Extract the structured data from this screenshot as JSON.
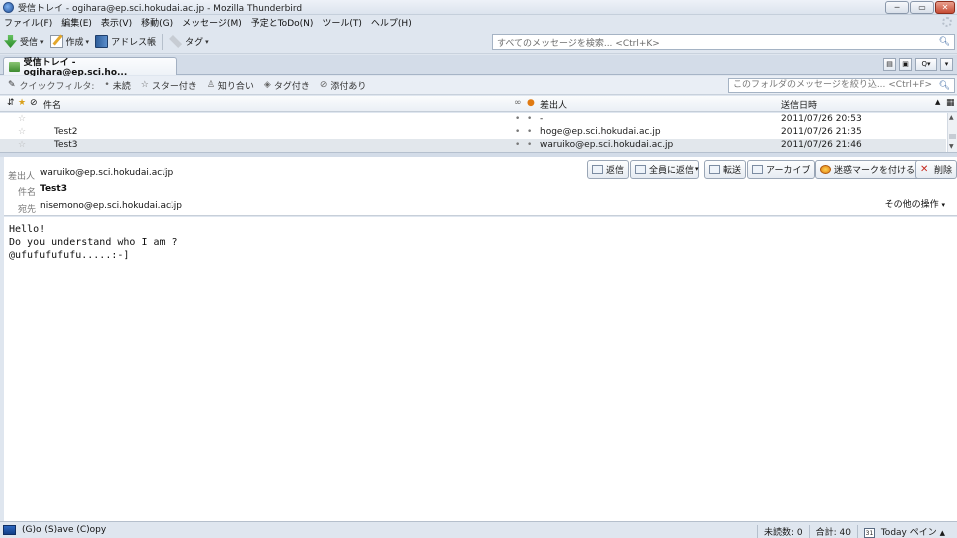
{
  "window": {
    "title": "受信トレイ - ogihara@ep.sci.hokudai.ac.jp - Mozilla Thunderbird",
    "minimize": "─",
    "maximize": "▭",
    "close": "✕"
  },
  "menubar": {
    "items": [
      "ファイル(F)",
      "編集(E)",
      "表示(V)",
      "移動(G)",
      "メッセージ(M)",
      "予定とToDo(N)",
      "ツール(T)",
      "ヘルプ(H)"
    ]
  },
  "toolbar": {
    "get_label": "受信",
    "write_label": "作成",
    "addressbook_label": "アドレス帳",
    "tag_label": "タグ",
    "search_placeholder": "すべてのメッセージを検索... <Ctrl+K>"
  },
  "tab": {
    "label": "受信トレイ - ogihara@ep.sci.ho..."
  },
  "quickfilter": {
    "label": "クイックフィルタ:",
    "unread": "未読",
    "starred": "スター付き",
    "contact": "知り合い",
    "tagged": "タグ付き",
    "attachment": "添付あり",
    "search_placeholder": "このフォルダのメッセージを絞り込... <Ctrl+F>"
  },
  "thread": {
    "col_subject": "件名",
    "col_sender": "差出人",
    "col_date": "送信日時",
    "rows": [
      {
        "subject": "",
        "sender": "-",
        "date": "2011/07/26 20:53"
      },
      {
        "subject": "Test2",
        "sender": "hoge@ep.sci.hokudai.ac.jp",
        "date": "2011/07/26 21:35"
      },
      {
        "subject": "Test3",
        "sender": "waruiko@ep.sci.hokudai.ac.jp",
        "date": "2011/07/26 21:46"
      }
    ]
  },
  "message": {
    "from_label": "差出人",
    "from": "waruiko@ep.sci.hokudai.ac.jp",
    "subject_label": "件名",
    "subject": "Test3",
    "to_label": "宛先",
    "to": "nisemono@ep.sci.hokudai.ac.jp",
    "reply": "返信",
    "reply_all": "全員に返信",
    "forward": "転送",
    "archive": "アーカイブ",
    "junk": "迷惑マークを付ける",
    "delete": "削除",
    "more": "その他の操作",
    "body": [
      "Hello!",
      "Do you understand who I am ?",
      "@ufufufufufu.....:-]"
    ]
  },
  "status": {
    "text": "(G)o (S)ave (C)opy",
    "unread": "未読数: 0",
    "total": "合計: 40",
    "today_pane": "Today ペイン",
    "cal_day": "31"
  }
}
